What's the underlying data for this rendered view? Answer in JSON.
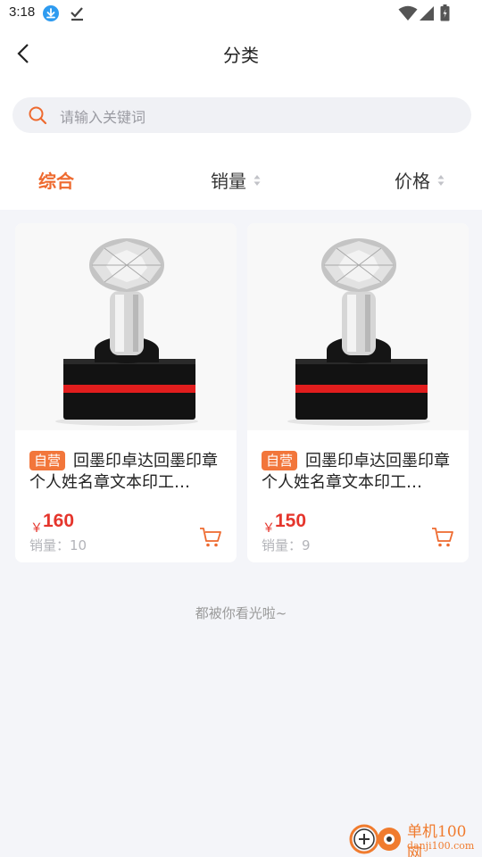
{
  "status_bar": {
    "time": "3:18"
  },
  "header": {
    "title": "分类",
    "search": {
      "placeholder": "请输入关键词"
    }
  },
  "tabs": [
    {
      "label": "综合",
      "active": true
    },
    {
      "label": "销量",
      "sortable": true
    },
    {
      "label": "价格",
      "sortable": true
    }
  ],
  "products": [
    {
      "badge": "自营",
      "title": "回墨印卓达回墨印章个人姓名章文本印工…",
      "currency": "￥",
      "price": "160",
      "sales_label": "销量：",
      "sales": "10"
    },
    {
      "badge": "自营",
      "title": "回墨印卓达回墨印章个人姓名章文本印工…",
      "currency": "￥",
      "price": "150",
      "sales_label": "销量：",
      "sales": "9"
    }
  ],
  "footer_text": "都被你看光啦~",
  "watermark": {
    "title": "单机100网",
    "url": "danji100.com"
  },
  "colors": {
    "accent": "#ee6a2f",
    "price": "#e5352c",
    "badge": "#f2763b",
    "background": "#f4f5f9"
  },
  "icons": [
    "download-icon",
    "check-icon",
    "wifi-icon",
    "signal-icon",
    "battery-icon",
    "back-icon",
    "search-icon",
    "sort-icon",
    "cart-icon"
  ]
}
